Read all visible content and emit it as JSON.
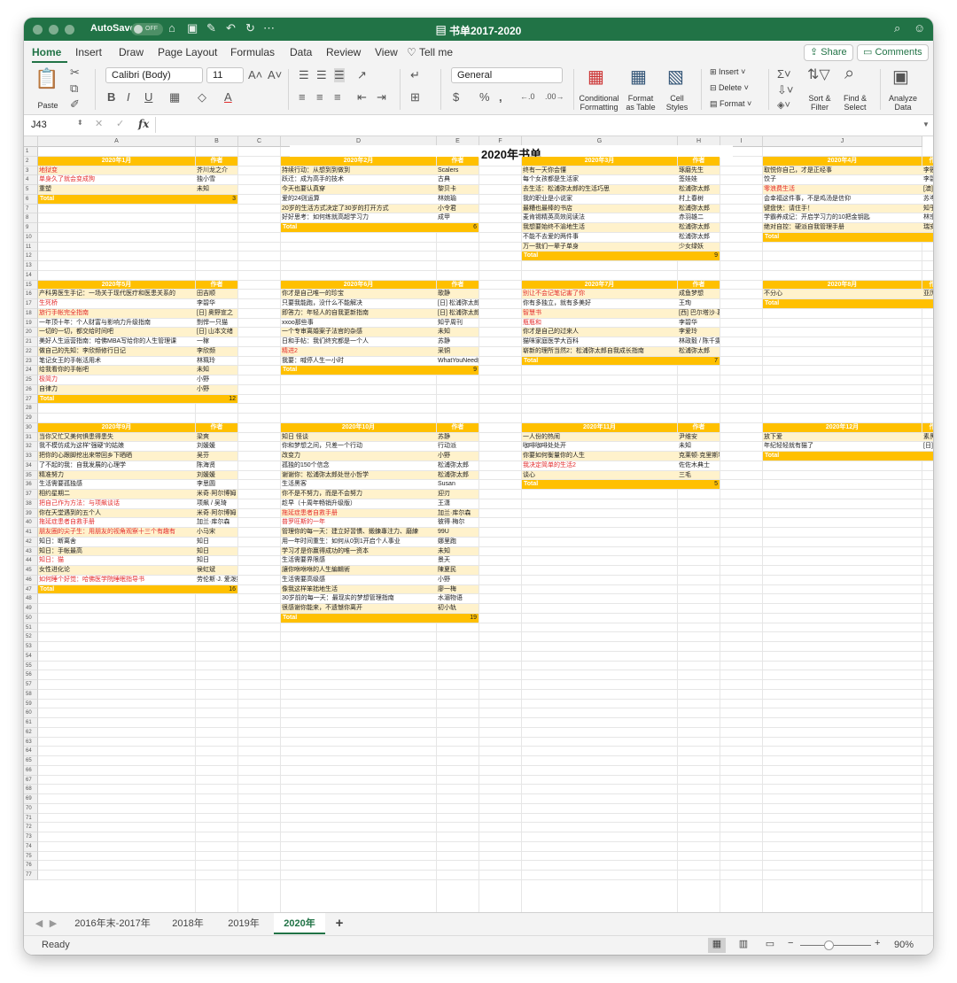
{
  "titlebar": {
    "autosave_label": "AutoSave",
    "autosave_state": "OFF",
    "doc_title": "书单2017-2020"
  },
  "ribbon_tabs": [
    "Home",
    "Insert",
    "Draw",
    "Page Layout",
    "Formulas",
    "Data",
    "Review",
    "View",
    "Tell me"
  ],
  "ribbon_buttons": {
    "share": "Share",
    "comments": "Comments"
  },
  "ribbon": {
    "paste": "Paste",
    "font": "Calibri (Body)",
    "size": "11",
    "number_format": "General",
    "conditional": "Conditional",
    "formatting": "Formatting",
    "format": "Format",
    "as_table": "as Table",
    "cell": "Cell",
    "styles": "Styles",
    "insert": "Insert",
    "delete": "Delete",
    "format2": "Format",
    "sort": "Sort &",
    "filter": "Filter",
    "find": "Find &",
    "select": "Select",
    "analyze": "Analyze",
    "data": "Data"
  },
  "formula_bar": {
    "name_box": "J43",
    "fx": "fx",
    "value": ""
  },
  "columns": [
    "A",
    "B",
    "C",
    "D",
    "E",
    "F",
    "G",
    "H",
    "I",
    "J"
  ],
  "rows": [
    "1",
    "2",
    "3",
    "4",
    "5",
    "6",
    "7",
    "8",
    "9",
    "10",
    "11",
    "12",
    "13",
    "14",
    "15",
    "16",
    "17",
    "18",
    "19",
    "20",
    "21",
    "22",
    "23",
    "24",
    "25",
    "26",
    "27",
    "28",
    "29",
    "30",
    "31",
    "32",
    "33",
    "34",
    "35",
    "36",
    "37",
    "38",
    "39",
    "40",
    "41",
    "42",
    "43",
    "44",
    "45",
    "46",
    "47",
    "48",
    "49",
    "50",
    "51",
    "52",
    "53",
    "54",
    "55",
    "56",
    "57",
    "58",
    "59",
    "60",
    "61",
    "62",
    "63",
    "64",
    "65",
    "66",
    "67",
    "68",
    "69",
    "70",
    "71",
    "72",
    "73",
    "74",
    "75",
    "76",
    "77"
  ],
  "sheet_title": "2020年书单",
  "author_header": "作者",
  "total_label": "Total",
  "blocks": [
    {
      "month": "2020年1月",
      "row": 2,
      "col": 0,
      "total": "3",
      "items": [
        {
          "title": "地狱变",
          "author": "芥川龙之介",
          "red": true
        },
        {
          "title": "单身久了就会变成狗",
          "author": "独小雪",
          "red": true
        },
        {
          "title": "重塑",
          "author": "未知",
          "red": false
        }
      ]
    },
    {
      "month": "2020年2月",
      "row": 2,
      "col": 1,
      "total": "6",
      "items": [
        {
          "title": "持续行动：从想到到做到",
          "author": "Scalers",
          "red": false
        },
        {
          "title": "跃迁：成为高手的技术",
          "author": "古典",
          "red": false
        },
        {
          "title": "今天也要认真穿",
          "author": "黎贝卡",
          "red": false
        },
        {
          "title": "爱的24则运算",
          "author": "林婉瑜",
          "red": false
        },
        {
          "title": "20岁的生活方式决定了30岁的打开方式",
          "author": "小令君",
          "red": false
        },
        {
          "title": "好好思考：如何练就高超学习力",
          "author": "成甲",
          "red": false
        }
      ]
    },
    {
      "month": "2020年3月",
      "row": 2,
      "col": 2,
      "total": "9",
      "items": [
        {
          "title": "终有一天你会懂",
          "author": "琢磨先生",
          "red": false
        },
        {
          "title": "每个女孩都是生活家",
          "author": "签娃娃",
          "red": false
        },
        {
          "title": "去生活：松浦弥太郎的生活巧思",
          "author": "松浦弥太郎",
          "red": false
        },
        {
          "title": "我的职业是小说家",
          "author": "村上春树",
          "red": false
        },
        {
          "title": "最糟也最棒的书店",
          "author": "松浦弥太郎",
          "red": false
        },
        {
          "title": "麦肯锡精英高效阅读法",
          "author": "赤羽雄二",
          "red": false
        },
        {
          "title": "我想要始终不渝地生活",
          "author": "松浦弥太郎",
          "red": false
        },
        {
          "title": "不能不去爱的两件事",
          "author": "松浦弥太郎",
          "red": false
        },
        {
          "title": "万一我们一辈子单身",
          "author": "少女绿妖",
          "red": false
        }
      ]
    },
    {
      "month": "2020年4月",
      "row": 2,
      "col": 3,
      "total": "",
      "items": [
        {
          "title": "取悦你自己，才是正经事",
          "author": "李筱",
          "red": false
        },
        {
          "title": "饺子",
          "author": "李碧",
          "red": false
        },
        {
          "title": "零浪费生活",
          "author": "[澳]",
          "red": true
        },
        {
          "title": "会幸福这件事，不是鸡汤是信仰",
          "author": "苏岑",
          "red": false
        },
        {
          "title": "键盘侠：请住手！",
          "author": "知乎",
          "red": false
        },
        {
          "title": "学霸养成记：开启学习力的10把金钥匙",
          "author": "林宗",
          "red": false
        },
        {
          "title": "绝对自控：硬派自我管理手册",
          "author": "瑞安",
          "red": false
        }
      ]
    },
    {
      "month": "2020年5月",
      "row": 15,
      "col": 0,
      "total": "12",
      "items": [
        {
          "title": "产科男医生手记：一场关于现代医疗和医患关系的",
          "author": "田吉顺",
          "red": false
        },
        {
          "title": "生死桥",
          "author": "李碧华",
          "red": true
        },
        {
          "title": "旅行手帐完全指南",
          "author": "[日] 奥野宣之",
          "red": true
        },
        {
          "title": "一年顶十年：个人财富与影响力升级指南",
          "author": "剽悍一只猫",
          "red": false
        },
        {
          "title": "一切的一切，都交给时间吧",
          "author": "[日] 山本文绪",
          "red": false
        },
        {
          "title": "美好人生运营指南：哈佛MBA写给你的人生管理课",
          "author": "一稼",
          "red": false
        },
        {
          "title": "做自己的先知：李欣频修行日记",
          "author": "李欣频",
          "red": false
        },
        {
          "title": "笔记女王的手帐活用术",
          "author": "林珮玲",
          "red": false
        },
        {
          "title": "给我看你的手帐吧",
          "author": "未知",
          "red": false
        },
        {
          "title": "极简力",
          "author": "小野",
          "red": true
        },
        {
          "title": "自律力",
          "author": "小野",
          "red": false
        }
      ]
    },
    {
      "month": "2020年6月",
      "row": 15,
      "col": 1,
      "total": "9",
      "items": [
        {
          "title": "你才是自己唯一的珍宝",
          "author": "歌静",
          "red": false
        },
        {
          "title": "只要我能跑，没什么不能解决",
          "author": "[日] 松浦弥太郎",
          "red": false
        },
        {
          "title": "即答力：年轻人的自我更新指南",
          "author": "[日] 松浦弥太郎",
          "red": false
        },
        {
          "title": "xxoo那些事",
          "author": "知乎周刊",
          "red": false
        },
        {
          "title": "一个专审离婚案子法官的杂感",
          "author": "未知",
          "red": false
        },
        {
          "title": "日和手帖：我们终究都是一个人",
          "author": "苏静",
          "red": false
        },
        {
          "title": "精进2",
          "author": "采铜",
          "red": true
        },
        {
          "title": "我要：喊停人生一小时",
          "author": "WhatYouNeed编辑部",
          "red": false
        }
      ]
    },
    {
      "month": "2020年7月",
      "row": 15,
      "col": 2,
      "total": "7",
      "items": [
        {
          "title": "别让不会记笔记害了你",
          "author": "成鱼梦想",
          "red": true
        },
        {
          "title": "你有多独立，就有多美好",
          "author": "王珣",
          "red": false
        },
        {
          "title": "智慧书",
          "author": "[西] 巴尔塔沙·葛拉西安",
          "red": true
        },
        {
          "title": "瓶瓶和",
          "author": "李碧华",
          "red": true
        },
        {
          "title": "你才是自己的过来人",
          "author": "李爱玲",
          "red": false
        },
        {
          "title": "猫咪家庭医学大百科",
          "author": "林政毅 / 陈千雯",
          "red": false
        },
        {
          "title": "崭新的理所当然2：松浦弥太郎自我成长指南",
          "author": "松浦弥太郎",
          "red": false
        }
      ]
    },
    {
      "month": "2020年8月",
      "row": 15,
      "col": 3,
      "total": "",
      "items": [
        {
          "title": "不分心",
          "author": "亚历",
          "red": false
        }
      ]
    },
    {
      "month": "2020年9月",
      "row": 30,
      "col": 0,
      "total": "16",
      "items": [
        {
          "title": "当你又忙又美何惧患得患失",
          "author": "梁爽",
          "red": false
        },
        {
          "title": "我不模仿成为这样\"强硬\"的姑娘",
          "author": "刘媛媛",
          "red": false
        },
        {
          "title": "把你的心跟脚挖出来带回乡下晒晒",
          "author": "吴芬",
          "red": false
        },
        {
          "title": "了不起的我：自我发展的心理学",
          "author": "陈海贤",
          "red": false
        },
        {
          "title": "精准努力",
          "author": "刘媛媛",
          "red": false
        },
        {
          "title": "生活需要孤独感",
          "author": "李思圆",
          "red": false
        },
        {
          "title": "相约星期二",
          "author": "米奇·阿尔博姆",
          "red": false
        },
        {
          "title": "把自己作为方法：与项飙谈话",
          "author": "项飙 / 吴琦",
          "red": true
        },
        {
          "title": "你在天堂遇到的五个人",
          "author": "米奇·阿尔博姆",
          "red": false
        },
        {
          "title": "拖延症患者自救手册",
          "author": "加兰·库尔森",
          "red": true
        },
        {
          "title": "朋友圈的尖子生：用朋友的视角观察十三个有趣有",
          "author": "小马宋",
          "red": true
        },
        {
          "title": "知日：断离舍",
          "author": "知日",
          "red": false
        },
        {
          "title": "知日：手帐最高",
          "author": "知日",
          "red": false
        },
        {
          "title": "知日：猫",
          "author": "知日",
          "red": true
        },
        {
          "title": "女性进化论",
          "author": "侯虹斌",
          "red": false
        },
        {
          "title": "如何睡个好觉：哈佛医学院睡眠指导书",
          "author": "劳伦斯·J. 爱泼斯坦",
          "red": true
        }
      ]
    },
    {
      "month": "2020年10月",
      "row": 30,
      "col": 1,
      "total": "19",
      "items": [
        {
          "title": "知日 怪谈",
          "author": "苏静",
          "red": false
        },
        {
          "title": "你和梦想之间，只差一个行动",
          "author": "行动派",
          "red": false
        },
        {
          "title": "改变力",
          "author": "小野",
          "red": false
        },
        {
          "title": "孤独的150个信念",
          "author": "松浦弥太郎",
          "red": false
        },
        {
          "title": "谢谢你：松浦弥太郎处世小哲学",
          "author": "松浦弥太郎",
          "red": false
        },
        {
          "title": "生活黑客",
          "author": "Susan",
          "red": false
        },
        {
          "title": "你不是不努力，而是不会努力",
          "author": "迎刃",
          "red": false
        },
        {
          "title": "趁早（十周年畅销升级版）",
          "author": "王潇",
          "red": false
        },
        {
          "title": "拖延症患者自救手册",
          "author": "加兰·库尔森",
          "red": true
        },
        {
          "title": "普罗旺斯的一年",
          "author": "彼得·梅尔",
          "red": true
        },
        {
          "title": "管理你的每一天：建立好習慣、鍛鍊專注力、磨練",
          "author": "99U",
          "red": false
        },
        {
          "title": "用一年时间重生：如何从0到1开启个人事业",
          "author": "娜里跑",
          "red": false
        },
        {
          "title": "学习才是你赢得成功的唯一资本",
          "author": "未知",
          "red": false
        },
        {
          "title": "生活需要界限感",
          "author": "景天",
          "red": false
        },
        {
          "title": "讓你咻咻咻的人生編輯術",
          "author": "陳夏民",
          "red": false
        },
        {
          "title": "生活需要高级感",
          "author": "小野",
          "red": false
        },
        {
          "title": "像我这样笨拙地生活",
          "author": "廖一梅",
          "red": false
        },
        {
          "title": "30岁前的每一天：最现实的梦想管理指南",
          "author": "水湄物语",
          "red": false
        },
        {
          "title": "很感谢你能来，不遗憾你离开",
          "author": "初小轨",
          "red": false
        }
      ]
    },
    {
      "month": "2020年11月",
      "row": 30,
      "col": 2,
      "total": "5",
      "items": [
        {
          "title": "一人份的热闹",
          "author": "尹维安",
          "red": false
        },
        {
          "title": "咖啡咖啡处处开",
          "author": "未知",
          "red": false
        },
        {
          "title": "你要如何衡量你的人生",
          "author": "克莱顿·克里斯坦森",
          "red": false
        },
        {
          "title": "我决定简单的生活2",
          "author": "佐佐木典士",
          "red": true
        },
        {
          "title": "谈心",
          "author": "三毛",
          "red": false
        }
      ]
    },
    {
      "month": "2020年12月",
      "row": 30,
      "col": 3,
      "total": "",
      "items": [
        {
          "title": "放下爱",
          "author": "素黑",
          "red": false
        },
        {
          "title": "年纪轻轻就有猫了",
          "author": "[日]",
          "red": false
        }
      ]
    }
  ],
  "sheet_tabs": [
    "2016年末-2017年",
    "2018年",
    "2019年",
    "2020年"
  ],
  "active_sheet": "2020年",
  "status": {
    "ready": "Ready",
    "zoom": "90%"
  },
  "colors": {
    "brand": "#217346",
    "header": "#ffc000",
    "band": "#fff2cc",
    "red_text": "#e32c2c"
  }
}
